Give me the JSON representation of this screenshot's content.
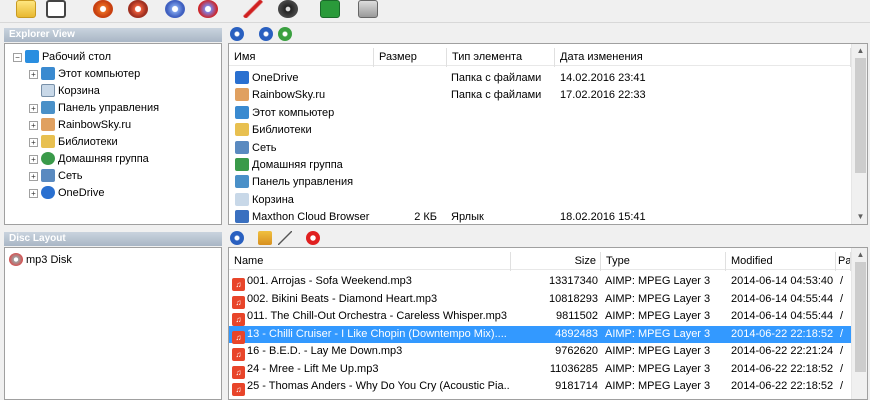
{
  "toolbar": {
    "icons": [
      "new-project-icon",
      "save-icon",
      "burn-icon",
      "burn-audio-icon",
      "copy-disc-icon",
      "erase-disc-icon",
      "clean-icon",
      "disc-info-icon",
      "refresh-icon",
      "exit-icon"
    ]
  },
  "explorer": {
    "title": "Explorer View",
    "tree": [
      "Рабочий стол",
      "Этот компьютер",
      "Корзина",
      "Панель управления",
      "RainbowSky.ru",
      "Библиотеки",
      "Домашняя группа",
      "Сеть",
      "OneDrive"
    ],
    "columns": {
      "name": "Имя",
      "size": "Размер",
      "type": "Тип элемента",
      "date": "Дата изменения"
    },
    "rows": [
      {
        "name": "OneDrive",
        "size": "",
        "type": "Папка с файлами",
        "date": "14.02.2016 23:41",
        "icon": "onedrive-icon"
      },
      {
        "name": "RainbowSky.ru",
        "size": "",
        "type": "Папка с файлами",
        "date": "17.02.2016 22:33",
        "icon": "user-folder-icon"
      },
      {
        "name": "Этот компьютер",
        "size": "",
        "type": "",
        "date": "",
        "icon": "computer-icon"
      },
      {
        "name": "Библиотеки",
        "size": "",
        "type": "",
        "date": "",
        "icon": "libraries-icon"
      },
      {
        "name": "Сеть",
        "size": "",
        "type": "",
        "date": "",
        "icon": "network-icon"
      },
      {
        "name": "Домашняя группа",
        "size": "",
        "type": "",
        "date": "",
        "icon": "homegroup-icon"
      },
      {
        "name": "Панель управления",
        "size": "",
        "type": "",
        "date": "",
        "icon": "control-panel-icon"
      },
      {
        "name": "Корзина",
        "size": "",
        "type": "",
        "date": "",
        "icon": "recycle-bin-icon"
      },
      {
        "name": "Maxthon Cloud Browser",
        "size": "2 КБ",
        "type": "Ярлык",
        "date": "18.02.2016 15:41",
        "icon": "shortcut-icon"
      }
    ]
  },
  "disc": {
    "title": "Disc Layout",
    "root": "mp3 Disk",
    "columns": {
      "name": "Name",
      "size": "Size",
      "type": "Type",
      "modified": "Modified",
      "path": "Pa"
    },
    "rows": [
      {
        "name": "001. Arrojas - Sofa Weekend.mp3",
        "size": "13317340",
        "type": "AIMP: MPEG Layer 3",
        "modified": "2014-06-14 04:53:40",
        "path": "/"
      },
      {
        "name": "002. Bikini Beats - Diamond Heart.mp3",
        "size": "10818293",
        "type": "AIMP: MPEG Layer 3",
        "modified": "2014-06-14 04:55:44",
        "path": "/"
      },
      {
        "name": "011. The Chill-Out Orchestra - Careless Whisper.mp3",
        "size": "9811502",
        "type": "AIMP: MPEG Layer 3",
        "modified": "2014-06-14 04:55:44",
        "path": "/"
      },
      {
        "name": "13 - Chilli Cruiser - I Like Chopin (Downtempo Mix)....",
        "size": "4892483",
        "type": "AIMP: MPEG Layer 3",
        "modified": "2014-06-22 22:18:52",
        "path": "/"
      },
      {
        "name": "16 - B.E.D. - Lay Me Down.mp3",
        "size": "9762620",
        "type": "AIMP: MPEG Layer 3",
        "modified": "2014-06-22 22:21:24",
        "path": "/"
      },
      {
        "name": "24 - Mree - Lift Me Up.mp3",
        "size": "11036285",
        "type": "AIMP: MPEG Layer 3",
        "modified": "2014-06-22 22:18:52",
        "path": "/"
      },
      {
        "name": "25 - Thomas Anders - Why Do You Cry (Acoustic Pia...",
        "size": "9181714",
        "type": "AIMP: MPEG Layer 3",
        "modified": "2014-06-22 22:18:52",
        "path": "/"
      }
    ]
  }
}
